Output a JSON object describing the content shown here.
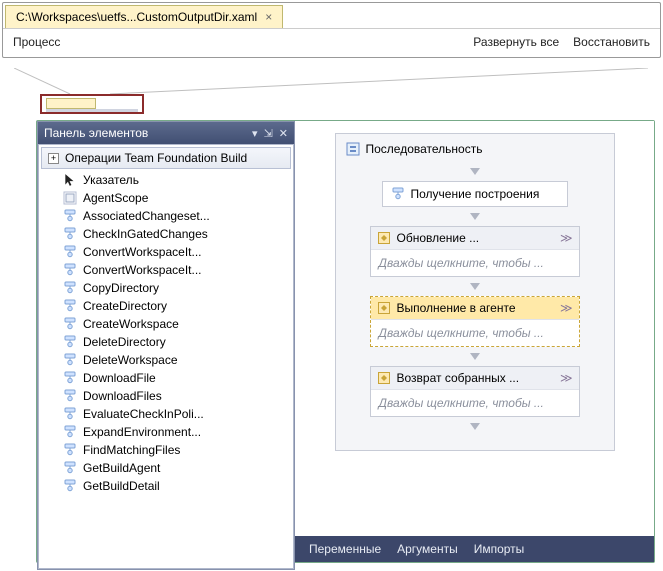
{
  "tab": {
    "title": "C:\\Workspaces\\uetfs...CustomOutputDir.xaml"
  },
  "toolbar": {
    "process": "Процесс",
    "expand_all": "Развернуть все",
    "restore": "Восстановить"
  },
  "toolbox": {
    "title": "Панель элементов",
    "category": "Операции Team Foundation Build",
    "items": [
      "Указатель",
      "AgentScope",
      "AssociatedChangeset...",
      "CheckInGatedChanges",
      "ConvertWorkspaceIt...",
      "ConvertWorkspaceIt...",
      "CopyDirectory",
      "CreateDirectory",
      "CreateWorkspace",
      "DeleteDirectory",
      "DeleteWorkspace",
      "DownloadFile",
      "DownloadFiles",
      "EvaluateCheckInPoli...",
      "ExpandEnvironment...",
      "FindMatchingFiles",
      "GetBuildAgent",
      "GetBuildDetail"
    ]
  },
  "canvas": {
    "sequence_title": "Последовательность",
    "hint": "Дважды щелкните, чтобы ...",
    "activities": [
      {
        "title": "Получение построения",
        "body": false,
        "highlight": false,
        "chevrons": false,
        "simple": true
      },
      {
        "title": "Обновление ...",
        "body": true,
        "highlight": false,
        "chevrons": true,
        "simple": false
      },
      {
        "title": "Выполнение в агенте",
        "body": true,
        "highlight": true,
        "chevrons": true,
        "simple": false
      },
      {
        "title": "Возврат собранных ...",
        "body": true,
        "highlight": false,
        "chevrons": true,
        "simple": false
      }
    ]
  },
  "bottom_tabs": [
    "Переменные",
    "Аргументы",
    "Импорты"
  ]
}
